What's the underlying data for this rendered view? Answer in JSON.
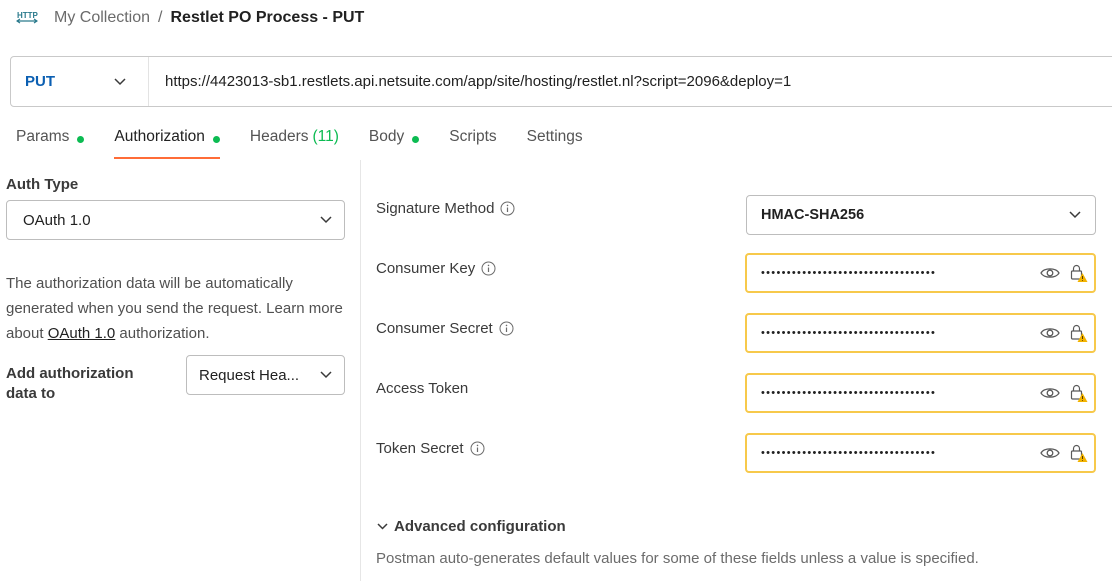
{
  "breadcrumb": {
    "icon": "http-icon",
    "parent": "My Collection",
    "separator": "/",
    "title": "Restlet PO Process - PUT"
  },
  "request": {
    "method": "PUT",
    "url": "https://4423013-sb1.restlets.api.netsuite.com/app/site/hosting/restlet.nl?script=2096&deploy=1"
  },
  "tabs": [
    {
      "label": "Params",
      "dot": true
    },
    {
      "label": "Authorization",
      "dot": true,
      "active": true
    },
    {
      "label": "Headers",
      "count": "(11)"
    },
    {
      "label": "Body",
      "dot": true
    },
    {
      "label": "Scripts"
    },
    {
      "label": "Settings"
    }
  ],
  "auth": {
    "type_label": "Auth Type",
    "type_value": "OAuth 1.0",
    "desc_part1": "The authorization data will be automatically generated when you send the request. Learn more about ",
    "desc_link": "OAuth 1.0",
    "desc_part2": " authorization.",
    "add_to_label": "Add authorization data to",
    "add_to_value": "Request Hea..."
  },
  "fields": {
    "signature_method": {
      "label": "Signature Method",
      "value": "HMAC-SHA256"
    },
    "consumer_key": {
      "label": "Consumer Key",
      "value": "••••••••••••••••••••••••••••••••••"
    },
    "consumer_secret": {
      "label": "Consumer Secret",
      "value": "••••••••••••••••••••••••••••••••••"
    },
    "access_token": {
      "label": "Access Token",
      "value": "••••••••••••••••••••••••••••••••••"
    },
    "token_secret": {
      "label": "Token Secret",
      "value": "••••••••••••••••••••••••••••••••••"
    }
  },
  "advanced": {
    "label": "Advanced configuration",
    "description": "Postman auto-generates default values for some of these fields unless a value is specified."
  },
  "colors": {
    "accent_tab": "#ff6c37",
    "dot_green": "#0cbb52",
    "method_blue": "#0b5fb2",
    "warning_border": "#f7c94b"
  }
}
